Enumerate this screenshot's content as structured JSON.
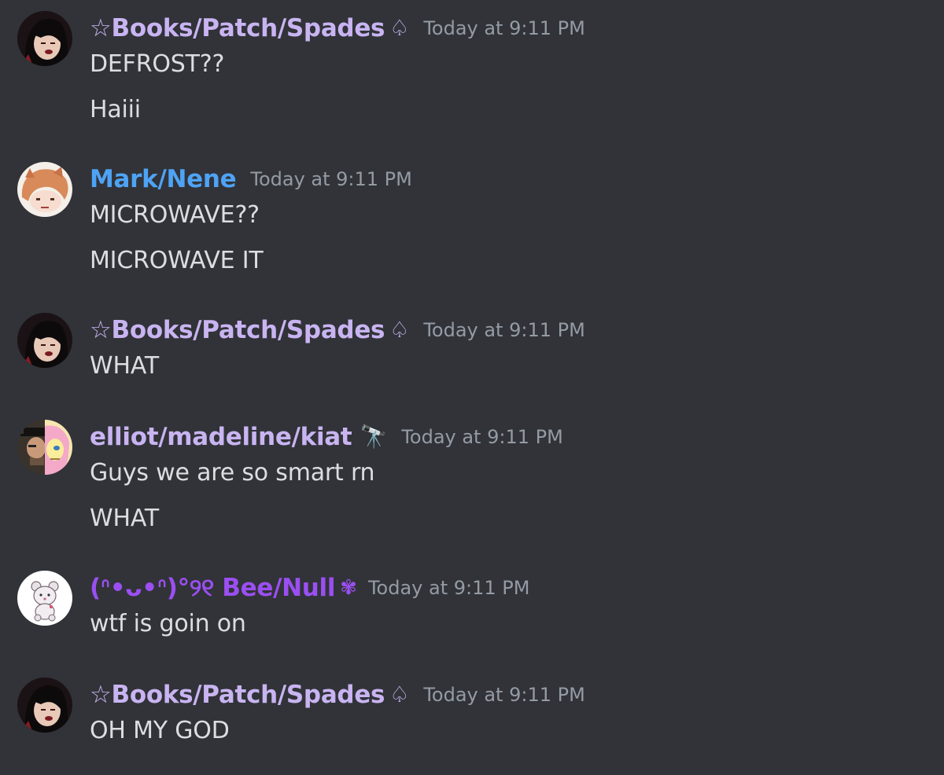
{
  "colors": {
    "background": "#313338",
    "name_books": "#c9b4f2",
    "name_mark": "#4ea3f5",
    "name_elliot": "#c9b4f2",
    "name_bee": "#9b4ff2",
    "timestamp": "#949ba4",
    "message_text": "#dbdee1"
  },
  "messages": [
    {
      "avatar": "dark-hair-character-avatar",
      "username": "☆Books/Patch/Spades",
      "tag_icon": "♤",
      "timestamp": "Today at 9:11 PM",
      "lines": [
        "DEFROST??",
        "Haiii"
      ]
    },
    {
      "avatar": "orange-hair-character-avatar",
      "username": "Mark/Nene",
      "tag_icon": "",
      "timestamp": "Today at 9:11 PM",
      "lines": [
        "MICROWAVE??",
        "MICROWAVE IT"
      ]
    },
    {
      "avatar": "dark-hair-character-avatar",
      "username": "☆Books/Patch/Spades",
      "tag_icon": "♤",
      "timestamp": "Today at 9:11 PM",
      "lines": [
        "WHAT"
      ]
    },
    {
      "avatar": "split-face-avatar",
      "username": "elliot/madeline/kiat",
      "tag_icon": "🔭",
      "timestamp": "Today at 9:11 PM",
      "lines": [
        "Guys we are so smart rn",
        "WHAT"
      ]
    },
    {
      "avatar": "teddy-bear-avatar",
      "username": "(ᐢ•ᴗ•ᐢ)°୨୧ Bee/Null",
      "tag_icon": "✾",
      "timestamp": "Today at 9:11 PM",
      "lines": [
        "wtf is goin on"
      ]
    },
    {
      "avatar": "dark-hair-character-avatar",
      "username": "☆Books/Patch/Spades",
      "tag_icon": "♤",
      "timestamp": "Today at 9:11 PM",
      "lines": [
        "OH MY GOD"
      ]
    }
  ]
}
